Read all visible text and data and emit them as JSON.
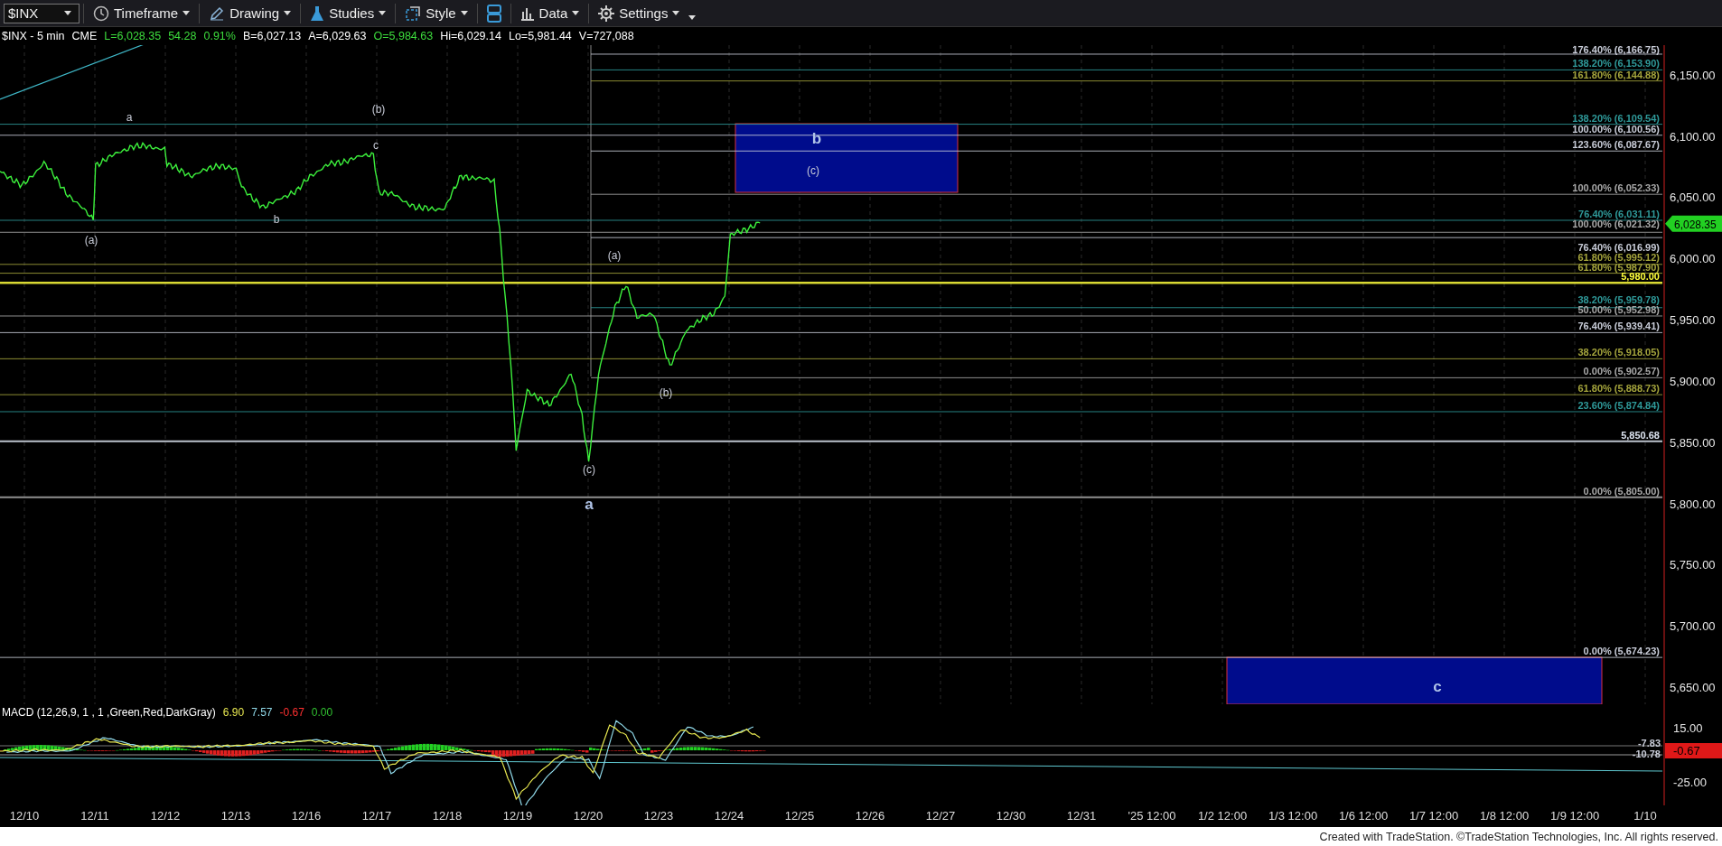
{
  "toolbar": {
    "symbol": "$INX",
    "menus": [
      "Timeframe",
      "Drawing",
      "Studies",
      "Style",
      "Data",
      "Settings"
    ]
  },
  "quote": [
    {
      "text": "$INX - 5 min",
      "color": "#ffffff"
    },
    {
      "text": "CME",
      "color": "#ffffff"
    },
    {
      "text": "L=6,028.35",
      "color": "#3ddc3d"
    },
    {
      "text": "54.28",
      "color": "#3ddc3d"
    },
    {
      "text": "0.91%",
      "color": "#3ddc3d"
    },
    {
      "text": "B=6,027.13",
      "color": "#ffffff"
    },
    {
      "text": "A=6,029.63",
      "color": "#ffffff"
    },
    {
      "text": "O=5,984.63",
      "color": "#3ddc3d"
    },
    {
      "text": "Hi=6,029.14",
      "color": "#ffffff"
    },
    {
      "text": "Lo=5,981.44",
      "color": "#ffffff"
    },
    {
      "text": "V=727,088",
      "color": "#ffffff"
    }
  ],
  "chart": {
    "price_axis": [
      "6,150.00",
      "6,100.00",
      "6,050.00",
      "6,000.00",
      "5,950.00",
      "5,900.00",
      "5,850.00",
      "5,800.00",
      "5,750.00",
      "5,700.00",
      "5,650.00"
    ],
    "current_price": "6,028.35",
    "levels": [
      {
        "label": "176.40% (6,166.75)",
        "color": "#c8ccd8"
      },
      {
        "label": "138.20% (6,153.90)",
        "color": "#2f9a9a"
      },
      {
        "label": "161.80% (6,144.88)",
        "color": "#a4a43c"
      },
      {
        "label": "138.20% (6,109.54)",
        "color": "#2f9a9a"
      },
      {
        "label": "100.00% (6,100.56)",
        "color": "#c8ccd8"
      },
      {
        "label": "123.60% (6,087.67)",
        "color": "#c8ccd8"
      },
      {
        "label": "100.00% (6,052.33)",
        "color": "#a8a8a8"
      },
      {
        "label": "76.40% (6,031.11)",
        "color": "#2f9a9a"
      },
      {
        "label": "100.00% (6,021.32)",
        "color": "#a8a8a8"
      },
      {
        "label": "76.40% (6,016.99)",
        "color": "#c8ccd8"
      },
      {
        "label": "61.80% (5,995.12)",
        "color": "#a4a43c"
      },
      {
        "label": "61.80% (5,987.90)",
        "color": "#a4a43c"
      },
      {
        "label": "5,980.00",
        "color": "#ffff3c"
      },
      {
        "label": "38.20% (5,959.78)",
        "color": "#2f9a9a"
      },
      {
        "label": "50.00% (5,952.98)",
        "color": "#a8a8a8"
      },
      {
        "label": "76.40% (5,939.41)",
        "color": "#c8ccd8"
      },
      {
        "label": "38.20% (5,918.05)",
        "color": "#a4a43c"
      },
      {
        "label": "0.00% (5,902.57)",
        "color": "#a8a8a8"
      },
      {
        "label": "61.80% (5,888.73)",
        "color": "#a4a43c"
      },
      {
        "label": "23.60% (5,874.84)",
        "color": "#2f9a9a"
      },
      {
        "label": "5,850.68",
        "color": "#dde4f0"
      },
      {
        "label": "0.00% (5,805.00)",
        "color": "#a8a8a8"
      },
      {
        "label": "0.00% (5,674.23)",
        "color": "#c8ccd8"
      }
    ],
    "wave_labels": [
      {
        "text": "a",
        "kind": "minor"
      },
      {
        "text": "(b)",
        "kind": "minor"
      },
      {
        "text": "c",
        "kind": "minor"
      },
      {
        "text": "(a)",
        "kind": "minor"
      },
      {
        "text": "b",
        "kind": "minor"
      },
      {
        "text": "(a)",
        "kind": "minor"
      },
      {
        "text": "(c)",
        "kind": "minor"
      },
      {
        "text": "a",
        "kind": "major"
      },
      {
        "text": "(b)",
        "kind": "minor"
      }
    ],
    "target_zones": [
      {
        "labels": [
          {
            "text": "b",
            "kind": "major"
          },
          {
            "text": "(c)",
            "kind": "minor"
          }
        ]
      },
      {
        "labels": [
          {
            "text": "c",
            "kind": "major"
          }
        ]
      }
    ]
  },
  "macd": {
    "title": "MACD (12,26,9, 1 , 1 ,Green,Red,DarkGray)",
    "values": [
      {
        "text": "6.90",
        "color": "#e6e650"
      },
      {
        "text": "7.57",
        "color": "#8fd8e8"
      },
      {
        "text": "-0.67",
        "color": "#ff3030"
      },
      {
        "text": "0.00",
        "color": "#30c030"
      }
    ],
    "axis": [
      "15.00",
      "-25.00"
    ],
    "markers": [
      "-7.83",
      "-10.78"
    ],
    "tag": "-0.67"
  },
  "dates": [
    "12/10",
    "12/11",
    "12/12",
    "12/13",
    "12/16",
    "12/17",
    "12/18",
    "12/19",
    "12/20",
    "12/23",
    "12/24",
    "12/25",
    "12/26",
    "12/27",
    "12/30",
    "12/31",
    "'25 12:00",
    "1/2 12:00",
    "1/3 12:00",
    "1/6 12:00",
    "1/7 12:00",
    "1/8 12:00",
    "1/9 12:00",
    "1/10"
  ],
  "footer": "Created with TradeStation. ©TradeStation Technologies, Inc. All rights reserved."
}
